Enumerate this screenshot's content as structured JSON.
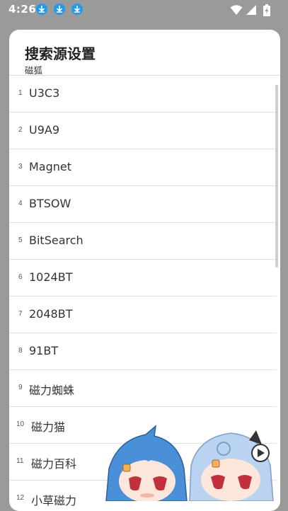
{
  "status_bar": {
    "time": "4:26",
    "notification_icons": [
      "download-icon",
      "download-icon",
      "download-icon"
    ],
    "system_icons": [
      "wifi-icon",
      "signal-icon",
      "battery-charging-icon"
    ]
  },
  "dialog": {
    "title": "搜索源设置",
    "subtitle": "磁狐",
    "items": [
      {
        "index": "1",
        "label": "U3C3"
      },
      {
        "index": "2",
        "label": "U9A9"
      },
      {
        "index": "3",
        "label": "Magnet"
      },
      {
        "index": "4",
        "label": "BTSOW"
      },
      {
        "index": "5",
        "label": "BitSearch"
      },
      {
        "index": "6",
        "label": "1024BT"
      },
      {
        "index": "7",
        "label": "2048BT"
      },
      {
        "index": "8",
        "label": "91BT"
      },
      {
        "index": "9",
        "label": "磁力蜘蛛"
      },
      {
        "index": "10",
        "label": "磁力猫"
      },
      {
        "index": "11",
        "label": "磁力百科"
      },
      {
        "index": "12",
        "label": "小草磁力"
      }
    ]
  },
  "decoration": {
    "mascot": "anime-mascot-illustration"
  },
  "colors": {
    "status_icon_blue": "#1d9bf0",
    "backdrop": "#9a9a9a",
    "dialog_bg": "#ffffff",
    "divider": "#e2e2e2",
    "mascot_hair_blue": "#4a90d9",
    "mascot_hair_light": "#b9d3f0"
  }
}
